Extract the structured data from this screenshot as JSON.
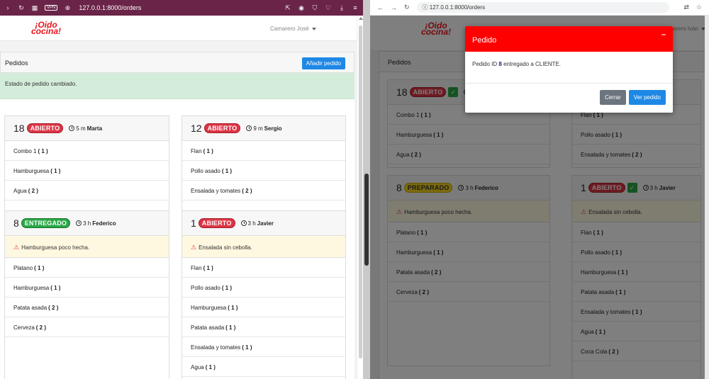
{
  "left": {
    "url": "127.0.0.1:8000/orders",
    "vpn": "VPN",
    "logo_line1": "¡Oido",
    "logo_line2": "cocina!",
    "user": "Camarero José",
    "panel_title": "Pedidos",
    "add_button": "Añadir pedido",
    "alert": "Estado de pedido cambiado.",
    "orders": [
      {
        "id": "18",
        "status": "ABIERTO",
        "status_color": "#dc3545",
        "time": "5 m",
        "waiter": "Marta",
        "items": [
          {
            "name": "Combo 1",
            "qty": "( 1 )"
          },
          {
            "name": "Hamburguesa",
            "qty": "( 1 )"
          },
          {
            "name": "Agua",
            "qty": "( 2 )"
          }
        ]
      },
      {
        "id": "12",
        "status": "ABIERTO",
        "status_color": "#dc3545",
        "time": "9 m",
        "waiter": "Sergio",
        "items": [
          {
            "name": "Flan",
            "qty": "( 1 )"
          },
          {
            "name": "Pollo asado",
            "qty": "( 1 )"
          },
          {
            "name": "Ensalada y tomates",
            "qty": "( 2 )"
          }
        ]
      },
      {
        "id": "8",
        "status": "ENTREGADO",
        "status_color": "#28a745",
        "time": "3 h",
        "waiter": "Federico",
        "note": "Hamburguesa poco hecha.",
        "items": [
          {
            "name": "Platano",
            "qty": "( 1 )"
          },
          {
            "name": "Hamburguesa",
            "qty": "( 1 )"
          },
          {
            "name": "Patata asada",
            "qty": "( 2 )"
          },
          {
            "name": "Cerveza",
            "qty": "( 2 )"
          }
        ]
      },
      {
        "id": "1",
        "status": "ABIERTO",
        "status_color": "#dc3545",
        "time": "3 h",
        "waiter": "Javier",
        "note": "Ensalada sin cebolla.",
        "items": [
          {
            "name": "Flan",
            "qty": "( 1 )"
          },
          {
            "name": "Pollo asado",
            "qty": "( 1 )"
          },
          {
            "name": "Hamburguesa",
            "qty": "( 1 )"
          },
          {
            "name": "Patata asada",
            "qty": "( 1 )"
          },
          {
            "name": "Ensalada y tomates",
            "qty": "( 1 )"
          },
          {
            "name": "Agua",
            "qty": "( 1 )"
          }
        ]
      }
    ]
  },
  "right": {
    "url": "127.0.0.1:8000/orders",
    "logo_line1": "¡Oido",
    "logo_line2": "cocina!",
    "user_partial": "Camarero Iván",
    "panel_title": "Pedidos",
    "orders": [
      {
        "id": "18",
        "status": "ABIERTO",
        "status_color": "#dc3545",
        "checked": true,
        "items": [
          {
            "name": "Combo 1",
            "qty": "( 1 )"
          },
          {
            "name": "Hamburguesa",
            "qty": "( 1 )"
          },
          {
            "name": "Agua",
            "qty": "( 2 )"
          }
        ]
      },
      {
        "id": "12",
        "items": [
          {
            "name": "Flan",
            "qty": "( 1 )"
          },
          {
            "name": "Pollo asado",
            "qty": "( 1 )"
          },
          {
            "name": "Ensalada y tomates",
            "qty": "( 2 )"
          }
        ]
      },
      {
        "id": "8",
        "status": "PREPARADO",
        "status_color": "#f7d51d",
        "time": "3 h",
        "waiter": "Federico",
        "note": "Hamburguesa poco hecha.",
        "items": [
          {
            "name": "Platano",
            "qty": "( 1 )"
          },
          {
            "name": "Hamburguesa",
            "qty": "( 1 )"
          },
          {
            "name": "Patata asada",
            "qty": "( 2 )"
          },
          {
            "name": "Cerveza",
            "qty": "( 2 )"
          }
        ]
      },
      {
        "id": "1",
        "status": "ABIERTO",
        "status_color": "#dc3545",
        "checked": true,
        "time": "3 h",
        "waiter": "Javier",
        "note": "Ensalada sin cebolla.",
        "items": [
          {
            "name": "Flan",
            "qty": "( 1 )"
          },
          {
            "name": "Pollo asado",
            "qty": "( 1 )"
          },
          {
            "name": "Hamburguesa",
            "qty": "( 1 )"
          },
          {
            "name": "Patata asada",
            "qty": "( 1 )"
          },
          {
            "name": "Ensalada y tomates",
            "qty": "( 1 )"
          },
          {
            "name": "Agua",
            "qty": "( 1 )"
          },
          {
            "name": "Coca Cola",
            "qty": "( 2 )"
          }
        ]
      }
    ],
    "modal": {
      "title": "Pedido",
      "close": "–",
      "message_pre": "Pedido ID",
      "message_id": "8",
      "message_post": "entregado a CLIENTE.",
      "cancel_button": "Cerrar",
      "view_button": "Ver pedido"
    }
  }
}
